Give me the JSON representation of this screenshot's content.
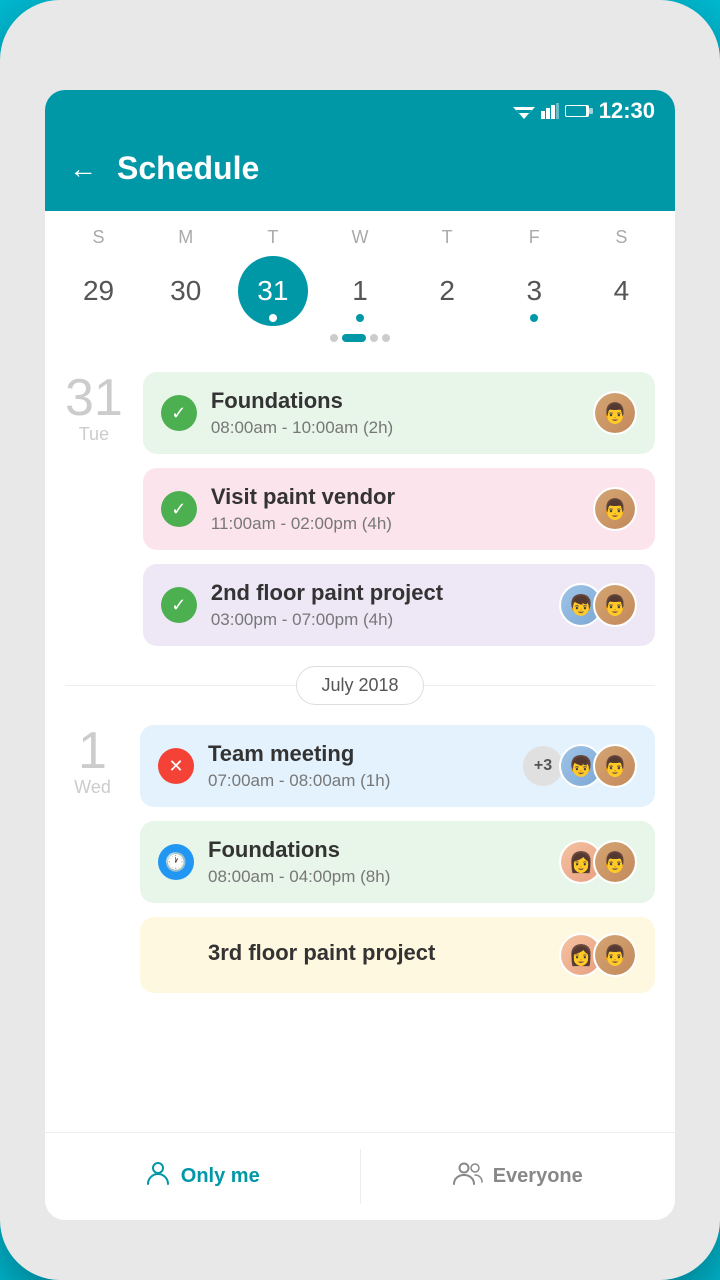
{
  "status_bar": {
    "time": "12:30"
  },
  "header": {
    "back_label": "←",
    "title": "Schedule"
  },
  "calendar": {
    "days": [
      {
        "label": "S",
        "number": "29",
        "selected": false,
        "has_dot": false
      },
      {
        "label": "M",
        "number": "30",
        "selected": false,
        "has_dot": false
      },
      {
        "label": "T",
        "number": "31",
        "selected": true,
        "has_dot": true
      },
      {
        "label": "W",
        "number": "1",
        "selected": false,
        "has_dot": true
      },
      {
        "label": "T",
        "number": "2",
        "selected": false,
        "has_dot": false
      },
      {
        "label": "F",
        "number": "3",
        "selected": false,
        "has_dot": true
      },
      {
        "label": "S",
        "number": "4",
        "selected": false,
        "has_dot": false
      }
    ]
  },
  "sections": [
    {
      "date_num": "31",
      "date_day": "Tue",
      "events": [
        {
          "title": "Foundations",
          "time": "08:00am - 10:00am (2h)",
          "color": "green",
          "icon": "check",
          "icon_color": "green",
          "avatars": [
            "man"
          ]
        },
        {
          "title": "Visit paint vendor",
          "time": "11:00am - 02:00pm (4h)",
          "color": "pink",
          "icon": "check",
          "icon_color": "green",
          "avatars": [
            "man"
          ]
        },
        {
          "title": "2nd floor paint project",
          "time": "03:00pm - 07:00pm (4h)",
          "color": "purple",
          "icon": "check",
          "icon_color": "green",
          "avatars": [
            "man2",
            "man"
          ]
        }
      ]
    }
  ],
  "month_divider": "July 2018",
  "sections2": [
    {
      "date_num": "1",
      "date_day": "Wed",
      "events": [
        {
          "title": "Team meeting",
          "time": "07:00am - 08:00am (1h)",
          "color": "blue",
          "icon": "x",
          "icon_color": "red",
          "plus": "+3",
          "avatars": [
            "man2",
            "man"
          ]
        },
        {
          "title": "Foundations",
          "time": "08:00am - 04:00pm (8h)",
          "color": "green",
          "icon": "clock",
          "icon_color": "blue",
          "avatars": [
            "woman",
            "man"
          ]
        },
        {
          "title": "3rd floor paint project",
          "time": "",
          "color": "beige",
          "icon": null,
          "avatars": [
            "woman",
            "man"
          ]
        }
      ]
    }
  ],
  "bottom_nav": {
    "only_me": {
      "label": "Only me",
      "active": true
    },
    "everyone": {
      "label": "Everyone",
      "active": false
    }
  }
}
